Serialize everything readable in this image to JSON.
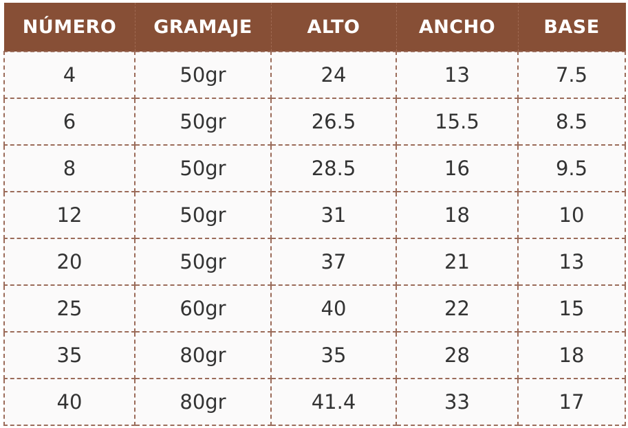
{
  "table": {
    "headers": [
      "NÚMERO",
      "GRAMAJE",
      "ALTO",
      "ANCHO",
      "BASE"
    ],
    "rows": [
      [
        "4",
        "50gr",
        "24",
        "13",
        "7.5"
      ],
      [
        "6",
        "50gr",
        "26.5",
        "15.5",
        "8.5"
      ],
      [
        "8",
        "50gr",
        "28.5",
        "16",
        "9.5"
      ],
      [
        "12",
        "50gr",
        "31",
        "18",
        "10"
      ],
      [
        "20",
        "50gr",
        "37",
        "21",
        "13"
      ],
      [
        "25",
        "60gr",
        "40",
        "22",
        "15"
      ],
      [
        "35",
        "80gr",
        "35",
        "28",
        "18"
      ],
      [
        "40",
        "80gr",
        "41.4",
        "33",
        "17"
      ]
    ]
  },
  "colors": {
    "header_bg": "#874f36",
    "header_text": "#ffffff",
    "cell_bg": "#fbfafa",
    "cell_text": "#333333",
    "border": "#9a6a58"
  }
}
